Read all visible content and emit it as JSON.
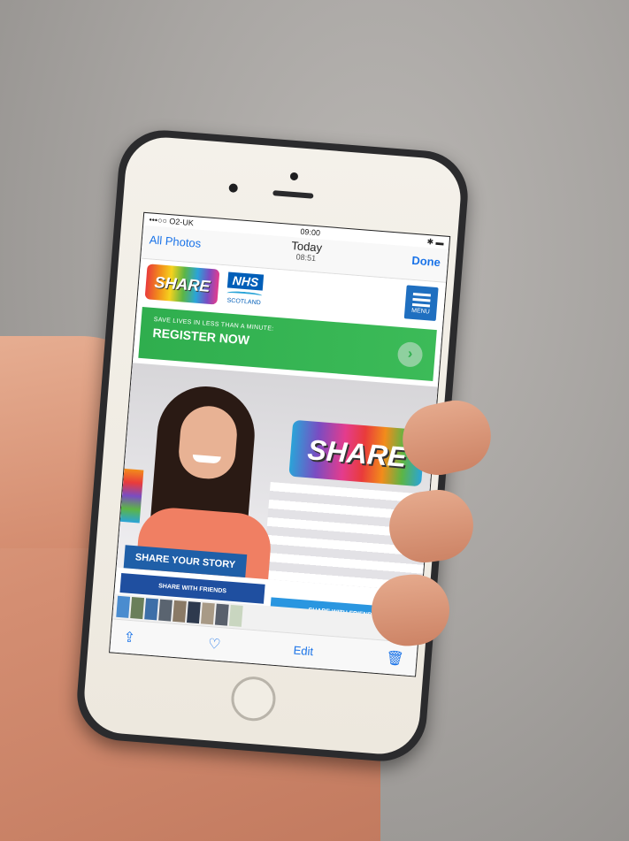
{
  "status_bar": {
    "carrier": "•••○○ O2-UK",
    "time": "09:00",
    "wifi_icon": "wifi-icon",
    "bluetooth_icon": "bluetooth-icon",
    "battery_icon": "battery-icon"
  },
  "photo_nav": {
    "back_label": "All Photos",
    "title": "Today",
    "subtitle": "08:51",
    "done_label": "Done"
  },
  "website": {
    "share_logo": "SHARE",
    "nhs_logo": "NHS",
    "nhs_region": "SCOTLAND",
    "menu_label": "MENU",
    "register_small": "SAVE LIVES IN LESS THAN A MINUTE:",
    "register_big": "REGISTER NOW",
    "hero_share": "SHARE",
    "story_tab": "SHARE YOUR STORY",
    "share_friends_left": "SHARE WITH FRIENDS",
    "share_friends_right": "SHARE WITH FRIENDS"
  },
  "toolbar": {
    "share_icon": "share-icon",
    "heart_icon": "heart-icon",
    "edit_label": "Edit",
    "trash_icon": "trash-icon"
  },
  "colors": {
    "ios_blue": "#1a73e8",
    "register_green": "#2fae4e",
    "nhs_blue": "#005eb8"
  }
}
